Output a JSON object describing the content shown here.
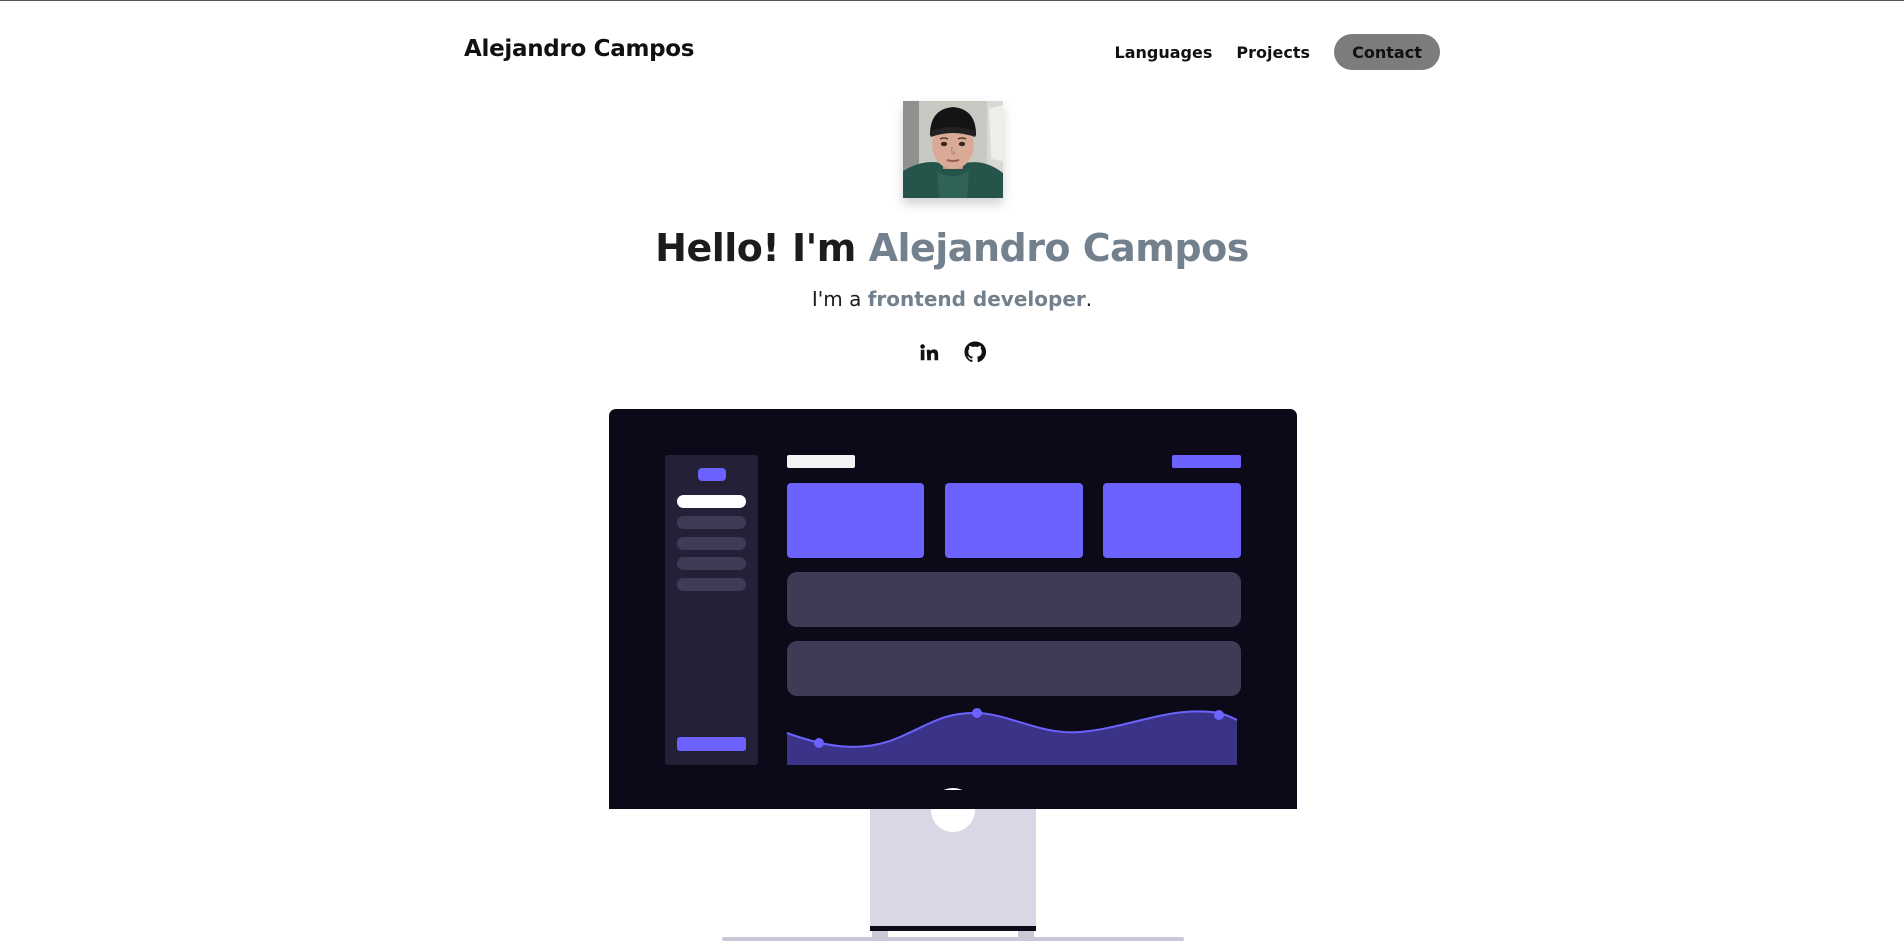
{
  "header": {
    "brand": "Alejandro Campos",
    "nav": [
      {
        "label": "Languages"
      },
      {
        "label": "Projects"
      }
    ],
    "contact_label": "Contact"
  },
  "hero": {
    "greeting": "Hello! I'm ",
    "name": "Alejandro Campos",
    "sub_prefix": "I'm a ",
    "role": "frontend developer",
    "sub_suffix": "."
  },
  "socials": [
    {
      "icon": "linkedin-icon"
    },
    {
      "icon": "github-icon"
    }
  ],
  "colors": {
    "accent_text": "#73818f",
    "monitor_screen": "#0c0a18",
    "illustration_purple": "#6c63ff",
    "contact_button": "#7c7c7c"
  }
}
